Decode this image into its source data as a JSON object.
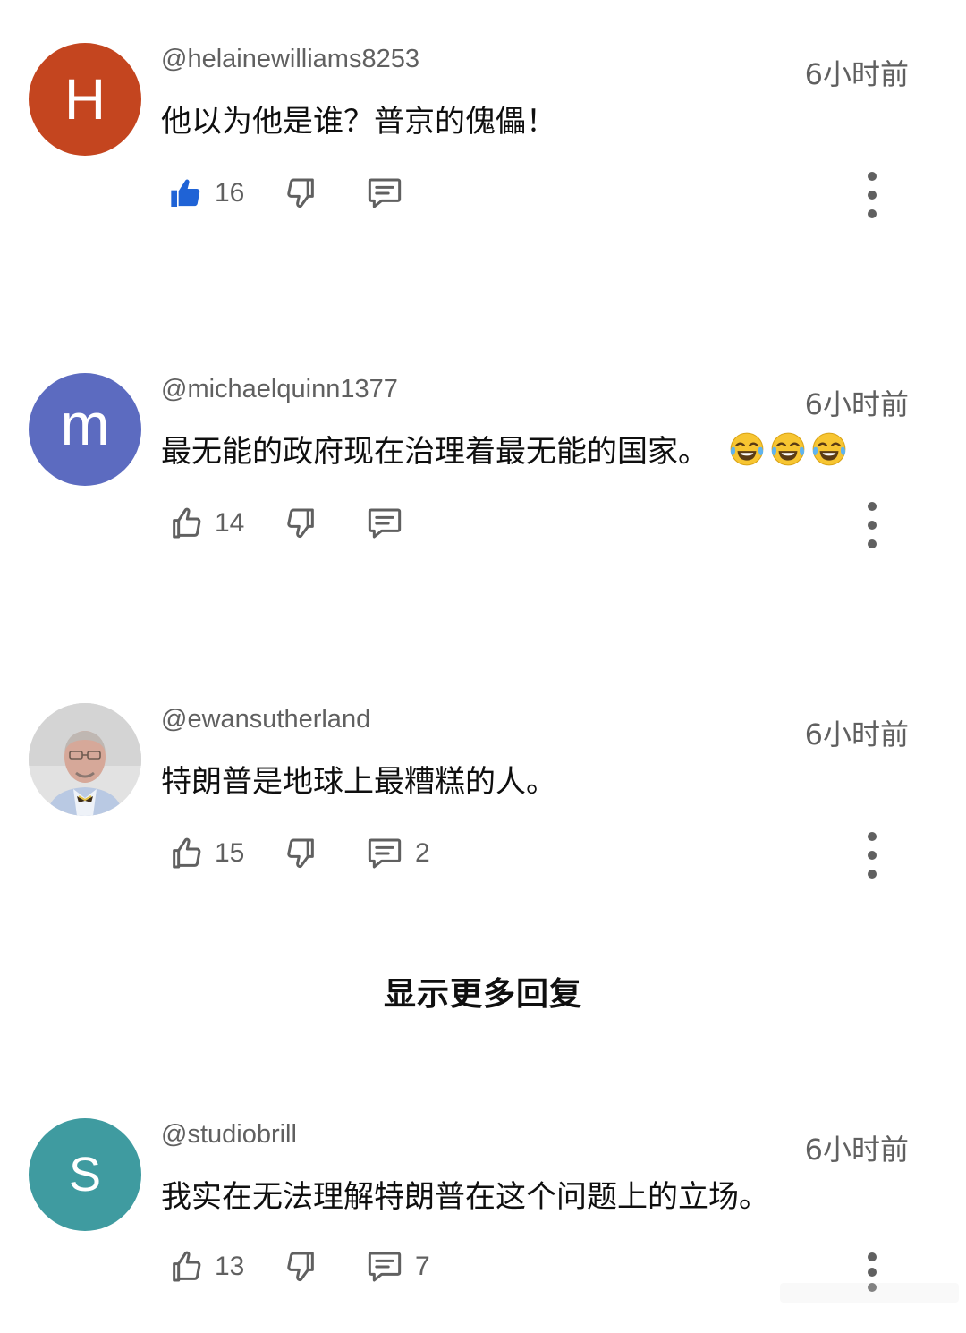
{
  "comments": [
    {
      "avatar_letter": "H",
      "avatar_color": "#c4451f",
      "handle": "@helainewilliams8253",
      "time": "6小时前",
      "text": "他以为他是谁？普京的傀儡！",
      "likes": "16",
      "liked": true,
      "replies": ""
    },
    {
      "avatar_letter": "m",
      "avatar_color": "#5c6bc0",
      "handle": "@michaelquinn1377",
      "time": "6小时前",
      "text": "最无能的政府现在治理着最无能的国家。",
      "emoji_count": 3,
      "emoji": "face-with-tears-of-joy",
      "likes": "14",
      "liked": false,
      "replies": ""
    },
    {
      "avatar_letter": "",
      "avatar_color": "#d9d9d9",
      "handle": "@ewansutherland",
      "time": "6小时前",
      "text": "特朗普是地球上最糟糕的人。",
      "likes": "15",
      "liked": false,
      "replies": "2"
    },
    {
      "avatar_letter": "S",
      "avatar_color": "#3f9ba0",
      "handle": "@studiobrill",
      "time": "6小时前",
      "text": "我实在无法理解特朗普在这个问题上的立场。",
      "likes": "13",
      "liked": false,
      "replies": "7"
    }
  ],
  "show_more_label": "显示更多回复",
  "colors": {
    "like_active": "#1f63d6",
    "icon": "#606060",
    "handle": "#606060",
    "text": "#0f0f0f"
  }
}
